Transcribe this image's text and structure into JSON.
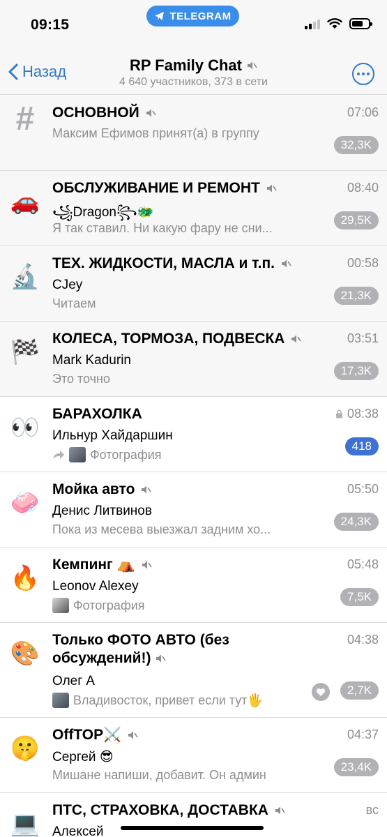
{
  "status_bar": {
    "time": "09:15",
    "app_pill": "TELEGRAM",
    "signal_icon": "cellular-signal-icon",
    "wifi_icon": "wifi-icon",
    "battery_icon": "battery-icon"
  },
  "navbar": {
    "back_label": "Назад",
    "title": "RP Family Chat",
    "subtitle": "4 640 участников, 373 в сети",
    "accent_color": "#3478c6"
  },
  "topics": [
    {
      "icon": "#",
      "title": "ОСНОВНОЙ",
      "time": "07:06",
      "sender": "",
      "preview": "Максим Ефимов принят(а) в группу",
      "badge": "32,3K",
      "pinned": true
    },
    {
      "icon": "🚗",
      "title": "ОБСЛУЖИВАНИЕ И РЕМОНТ",
      "time": "08:40",
      "sender": "꧁Dragon꧂🐲",
      "preview": "Я так ставил. Ни какую фару не сни...",
      "badge": "29,5K",
      "pinned": true
    },
    {
      "icon": "🔬",
      "title": "ТЕХ. ЖИДКОСТИ, МАСЛА и т.п.",
      "time": "00:58",
      "sender": "CJey",
      "preview": "Читаем",
      "badge": "21,3K",
      "pinned": true
    },
    {
      "icon": "🏁",
      "title": "КОЛЕСА, ТОРМОЗА, ПОДВЕСКА",
      "time": "03:51",
      "sender": "Mark Kadurin",
      "preview": "Это точно",
      "badge": "17,3K",
      "pinned": true
    },
    {
      "icon": "👀",
      "title": "БАРАХОЛКА",
      "time": "08:38",
      "sender": "Ильнур Хайдаршин",
      "preview": "Фотография",
      "badge": "418"
    },
    {
      "icon": "🧼",
      "title": "Мойка авто",
      "time": "05:50",
      "sender": "Денис Литвинов",
      "preview": "Пока из месева выезжал задним хо...",
      "badge": "24,3K"
    },
    {
      "icon": "🔥",
      "title": "Кемпинг ⛺",
      "time": "05:48",
      "sender": "Leonov Alexey",
      "preview": "Фотография",
      "badge": "7,5K"
    },
    {
      "icon": "🎨",
      "title": "Только ФОТО АВТО (без обсуждений!)",
      "time": "04:38",
      "sender": "Олег А",
      "preview": "Владивосток, привет если тут🖐",
      "badge": "2,7K"
    },
    {
      "icon": "🤫",
      "title": "OffTOP⚔️",
      "time": "04:37",
      "sender": "Сергей 😎",
      "preview": "Мишане напиши, добавит. Он админ",
      "badge": "23,4K"
    },
    {
      "icon": "💻",
      "title": "ПТС, СТРАХОВКА, ДОСТАВКА",
      "time": "вс",
      "sender": "Алексей",
      "preview": "",
      "badge": ""
    }
  ],
  "colors": {
    "badge_muted": "#b1b1b6",
    "badge_active": "#3d72d4",
    "pinned_background": "#f7f7f7"
  }
}
